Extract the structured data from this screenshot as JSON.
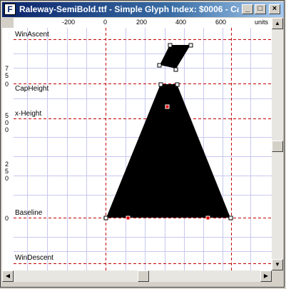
{
  "window": {
    "title": "Raleway-SemiBold.ttf - Simple Glyph Index: $0006 - Ca...",
    "app_icon_glyph": "F",
    "minimize_glyph": "_",
    "maximize_glyph": "□",
    "close_glyph": "×"
  },
  "ruler": {
    "top_ticks": [
      "-200",
      "0",
      "200",
      "400",
      "600"
    ],
    "units_label": "units",
    "left_ticks": [
      "7",
      "5",
      "0",
      "5",
      "0",
      "0",
      "2",
      "5",
      "0",
      "0"
    ]
  },
  "metrics": {
    "win_ascent": "WinAscent",
    "cap_height": "CapHeight",
    "x_height": "x-Height",
    "baseline": "Baseline",
    "win_descent": "WinDescent"
  },
  "scrollbars": {
    "up_arrow": "▲",
    "down_arrow": "▼",
    "left_arrow": "◀",
    "right_arrow": "▶"
  },
  "colors": {
    "grid": "#c8c8f0",
    "metric_line": "#c00000",
    "glyph_fill": "#000000",
    "on_curve_point": "#ffffff",
    "off_curve_point": "#e00000"
  }
}
